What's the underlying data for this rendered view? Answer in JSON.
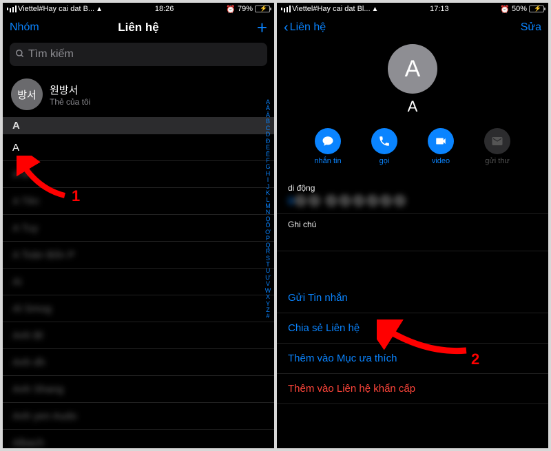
{
  "left": {
    "status": {
      "carrier": "Viettel#Hay cai dat B...",
      "time": "18:26",
      "battery_pct": "79%"
    },
    "nav": {
      "left_label": "Nhóm",
      "title": "Liên hệ"
    },
    "search_placeholder": "Tìm kiếm",
    "mycard": {
      "avatar_text": "방서",
      "name": "원방서",
      "sub": "Thẻ của tôi"
    },
    "section_letter": "A",
    "rows": [
      "A",
      "A M",
      "A Tên",
      "A Tuy",
      "A Toàn Bốn P",
      "Ai",
      "Al Smog",
      "Anh Bl",
      "Anh dh",
      "Anh Shang",
      "Anh yen Audo",
      "Albach"
    ],
    "index_letters": [
      "A",
      "Ă",
      "Â",
      "B",
      "C",
      "D",
      "Đ",
      "E",
      "Ê",
      "F",
      "G",
      "H",
      "I",
      "J",
      "K",
      "L",
      "M",
      "N",
      "O",
      "Ô",
      "Ơ",
      "P",
      "Q",
      "R",
      "S",
      "T",
      "U",
      "Ư",
      "V",
      "W",
      "X",
      "Y",
      "Z",
      "#"
    ]
  },
  "right": {
    "status": {
      "carrier": "Viettel#Hay cai dat Bl...",
      "time": "17:13",
      "battery_pct": "50%"
    },
    "nav": {
      "back_label": "Liên hệ",
      "right_label": "Sửa"
    },
    "contact_initial": "A",
    "contact_name": "A",
    "actions": {
      "message": "nhắn tin",
      "call": "gọi",
      "video": "video",
      "mail": "gửi thư"
    },
    "fields": {
      "mobile_label": "di động",
      "mobile_value": "0⚫⚫ ⚫⚫⚫⚫⚫⚫",
      "notes_label": "Ghi chú"
    },
    "links": {
      "send_msg": "Gửi Tin nhắn",
      "share": "Chia sẻ Liên hệ",
      "fav": "Thêm vào Mục ưa thích",
      "emergency": "Thêm vào Liên hệ khẩn cấp"
    }
  },
  "annotations": {
    "step1": "1",
    "step2": "2"
  }
}
